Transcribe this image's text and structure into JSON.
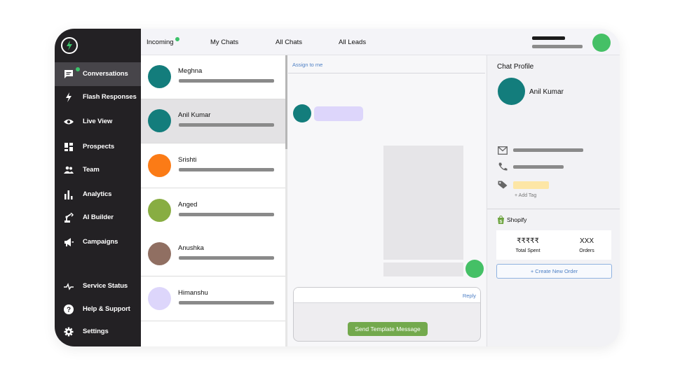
{
  "topbar": {
    "tabs": [
      {
        "label": "Incoming",
        "has_dot": true
      },
      {
        "label": "My Chats"
      },
      {
        "label": "All Chats"
      },
      {
        "label": "All Leads"
      }
    ]
  },
  "sidebar": {
    "items": [
      {
        "label": "Conversations",
        "icon": "chat-icon",
        "active": true
      },
      {
        "label": "Flash Responses",
        "icon": "bolt-icon"
      },
      {
        "label": "Live View",
        "icon": "eye-icon"
      },
      {
        "label": "Prospects",
        "icon": "dashboard-icon"
      },
      {
        "label": "Team",
        "icon": "team-icon"
      },
      {
        "label": "Analytics",
        "icon": "bar-chart-icon"
      },
      {
        "label": "AI Builder",
        "icon": "robot-arm-icon"
      },
      {
        "label": "Campaigns",
        "icon": "megaphone-icon"
      },
      {
        "label": "Service Status",
        "icon": "pulse-icon"
      },
      {
        "label": "Help & Support",
        "icon": "help-icon"
      },
      {
        "label": "Settings",
        "icon": "gear-icon"
      }
    ]
  },
  "chats": [
    {
      "name": "Meghna",
      "color": "#137d7c"
    },
    {
      "name": "Anil Kumar",
      "color": "#137d7c",
      "selected": true
    },
    {
      "name": "Srishti",
      "color": "#fb7b16"
    },
    {
      "name": "Anged",
      "color": "#88ad42"
    },
    {
      "name": "Anushka",
      "color": "#906f62"
    },
    {
      "name": "Himanshu",
      "color": "#ddd6fb"
    }
  ],
  "conversation": {
    "assign_label": "Assign to me",
    "reply_label": "Reply",
    "send_template_label": "Send Template Message"
  },
  "profile": {
    "title": "Chat Profile",
    "name": "Anil Kumar",
    "add_tag_label": "+ Add Tag",
    "shopify_label": "Shopify",
    "total_spent_value": "₹₹₹₹₹",
    "total_spent_label": "Total Spent",
    "orders_value": "XXX",
    "orders_label": "Orders",
    "create_order_label": "+ Create New Order"
  },
  "colors": {
    "sidebar_bg": "#232124",
    "online_green": "#3cc26a",
    "accent_blue": "#4d7fc4",
    "send_button": "#73a94d"
  }
}
